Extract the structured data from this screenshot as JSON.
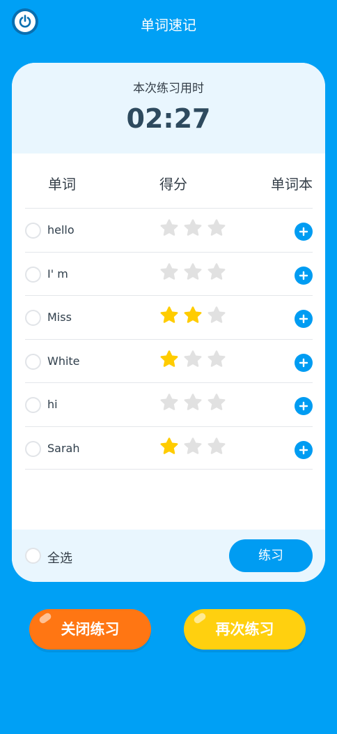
{
  "header": {
    "title": "单词速记",
    "power_icon": "power-icon"
  },
  "timer": {
    "label": "本次练习用时",
    "value": "02:27"
  },
  "table": {
    "headers": [
      "单词",
      "得分",
      "单词本"
    ],
    "rows": [
      {
        "word": "hello",
        "stars": 0
      },
      {
        "word": "I' m",
        "stars": 0
      },
      {
        "word": "Miss",
        "stars": 2
      },
      {
        "word": "White",
        "stars": 1
      },
      {
        "word": "hi",
        "stars": 0
      },
      {
        "word": "Sarah",
        "stars": 1
      }
    ],
    "max_stars": 3
  },
  "footer": {
    "select_all_label": "全选",
    "practice_label": "练习"
  },
  "actions": {
    "close_label": "关闭练习",
    "again_label": "再次练习"
  },
  "colors": {
    "background": "#00a0f5",
    "accent_blue": "#009cf2",
    "star_filled": "#ffcc00",
    "star_empty": "#e1e1e1",
    "close_button": "#ff7613",
    "again_button": "#ffd00f",
    "panel_tint": "#e9f6fe"
  }
}
